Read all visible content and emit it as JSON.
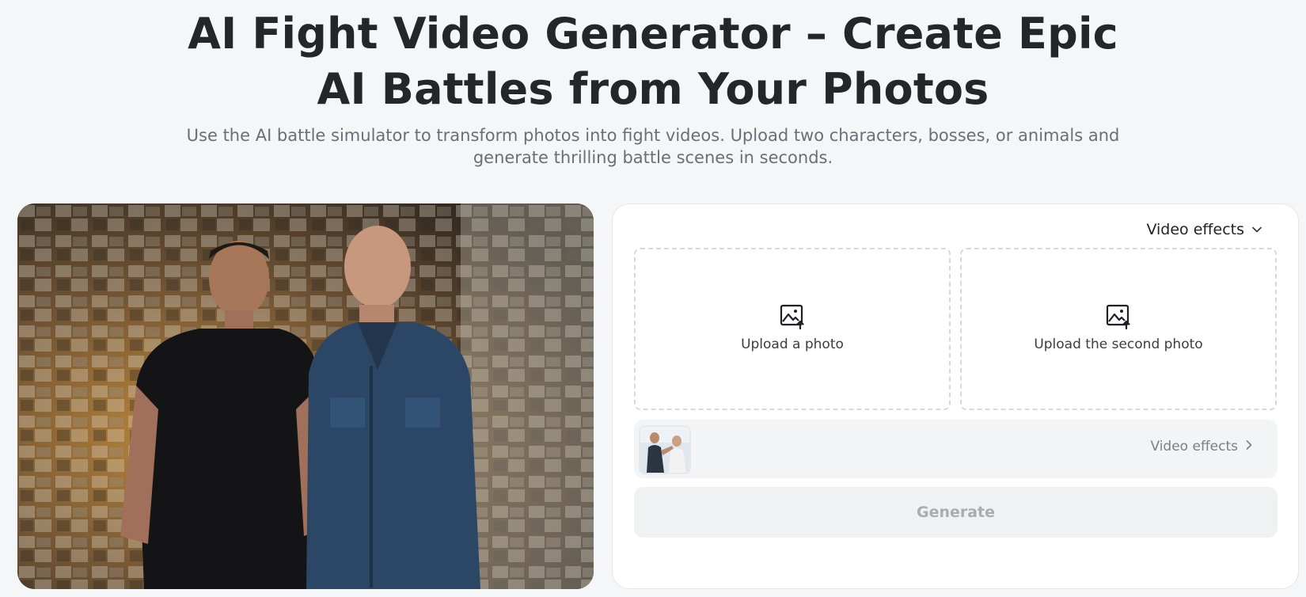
{
  "hero": {
    "title": "AI Fight Video Generator – Create Epic AI Battles from Your Photos",
    "subtitle": "Use the AI battle simulator to transform photos into fight videos. Upload two characters, bosses, or animals and generate thrilling battle scenes in seconds."
  },
  "panel": {
    "effects_dropdown_label": "Video effects",
    "upload_first_label": "Upload a photo",
    "upload_second_label": "Upload the second photo",
    "effect_link_label": "Video effects",
    "generate_label": "Generate"
  },
  "icons": {
    "dropdown": "chevron-down-icon",
    "upload": "image-upload-icon",
    "effect_link": "chevron-right-icon"
  },
  "colors": {
    "page_bg": "#f5f6f8",
    "title": "#24262b",
    "subtitle": "#6a6e76",
    "generate_disabled_text": "#a9acb2"
  }
}
